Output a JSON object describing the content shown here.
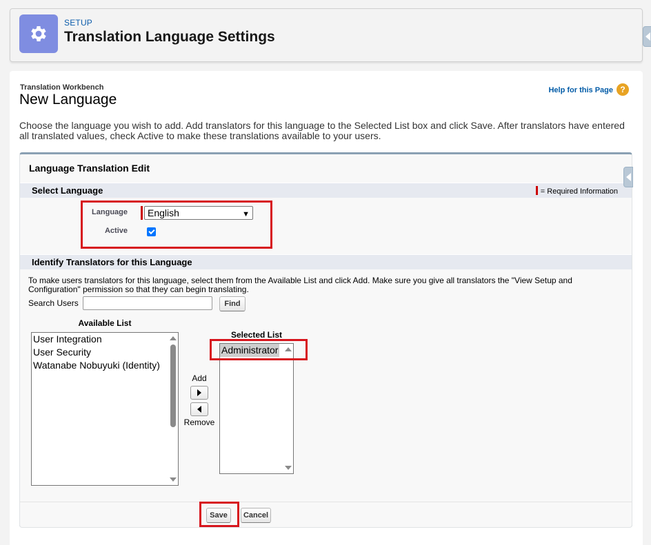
{
  "header": {
    "setup_label": "SETUP",
    "title": "Translation Language Settings",
    "icon": "gear-icon",
    "icon_bg": "#7f8de1"
  },
  "page": {
    "breadcrumb": "Translation Workbench",
    "heading": "New Language",
    "help_link": "Help for this Page",
    "help_icon_text": "?",
    "intro": "Choose the language you wish to add. Add translators for this language to the Selected List box and click Save. After translators have entered all translated values, check Active to make these translations available to your users."
  },
  "panel": {
    "title": "Language Translation Edit",
    "select_language_section": "Select Language",
    "required_info": "= Required Information",
    "language_label": "Language",
    "language_value": "English",
    "active_label": "Active",
    "active_checked": true,
    "translators_section": "Identify Translators for this Language",
    "instructions": "To make users translators for this language, select them from the Available List and click Add. Make sure you give all translators the \"View Setup and Configuration\" permission so that they can begin translating.",
    "search_label": "Search Users",
    "search_value": "",
    "find_button": "Find",
    "available_list_label": "Available List",
    "available_list": [
      "User Integration",
      "User Security",
      "Watanabe Nobuyuki (Identity)"
    ],
    "selected_list_label": "Selected List",
    "selected_list": [
      "Administrator"
    ],
    "add_label": "Add",
    "remove_label": "Remove"
  },
  "footer": {
    "save_button": "Save",
    "cancel_button": "Cancel"
  },
  "colors": {
    "accent": "#0b5cab",
    "highlight": "#d7151d",
    "required": "#cc0000"
  }
}
